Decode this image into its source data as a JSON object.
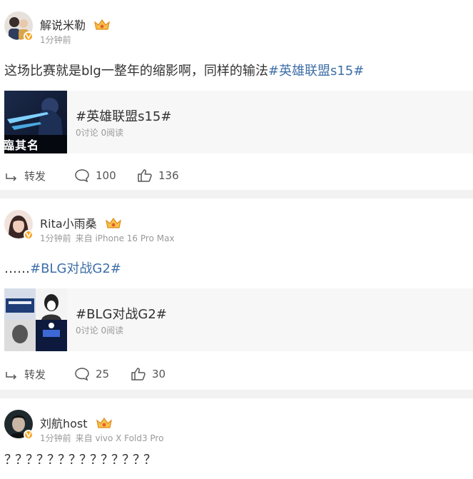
{
  "posts": [
    {
      "author": "解说米勒",
      "time": "1分钟前",
      "source": "",
      "text": "这场比赛就是blg一整年的缩影啊，同样的输法",
      "text_tag": "#英雄联盟s15#",
      "card": {
        "title": "#英雄联盟s15#",
        "meta": "0讨论 0阅读",
        "overlay": "臨其名"
      },
      "repost_label": "转发",
      "comments": "100",
      "likes": "136"
    },
    {
      "author": "Rita小雨桑",
      "time": "1分钟前",
      "source": "来自 iPhone 16 Pro Max",
      "text": "……",
      "text_tag": "#BLG对战G2#",
      "card": {
        "title": "#BLG对战G2#",
        "meta": "0讨论 0阅读"
      },
      "repost_label": "转发",
      "comments": "25",
      "likes": "30"
    },
    {
      "author": "刘航host",
      "time": "1分钟前",
      "source": "来自 vivo X Fold3 Pro",
      "text": "？？？？？？？？？？？？？？"
    }
  ],
  "colors": {
    "topic_link": "#3e6fa8",
    "meta_gray": "#999999",
    "verified_badge": "#f7a41d",
    "separator": "#f2f2f2"
  },
  "icons": [
    "verified-badge-icon",
    "crown-icon",
    "repost-icon",
    "comment-icon",
    "like-icon"
  ]
}
